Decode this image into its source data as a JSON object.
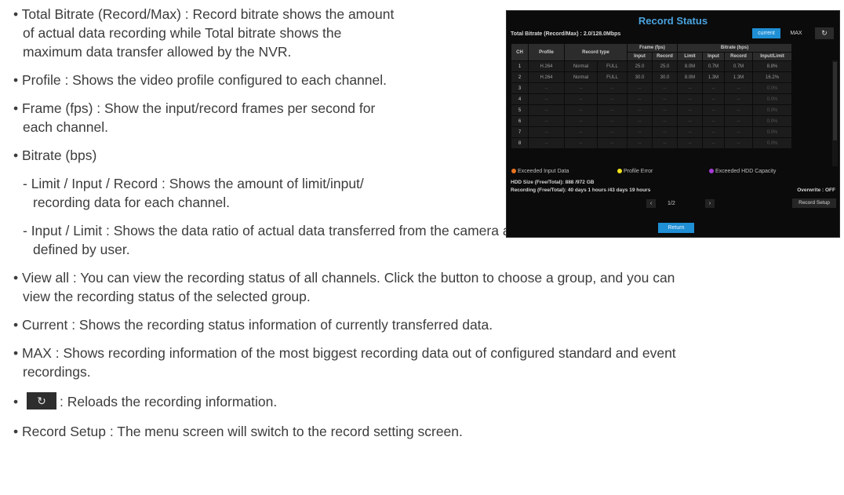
{
  "text": {
    "b1_l1": "• Total Bitrate (Record/Max) : Record bitrate shows the amount",
    "b1_l2": "of actual data recording while Total bitrate shows the",
    "b1_l3": "maximum data transfer allowed by the NVR.",
    "b2": "• Profile : Shows the video profile configured to each channel.",
    "b3_l1": "• Frame (fps) : Show the input/record frames per second for",
    "b3_l2": "each channel.",
    "b4": "• Bitrate (bps)",
    "b5_l1": "- Limit / Input / Record : Shows the amount of limit/input/",
    "b5_l2": "recording data for each channel.",
    "b6_l1": "- Input / Limit : Shows the data ratio of actual data transferred from the camera and allowed maximum",
    "b6_l2": "defined by user.",
    "b7_l1": "• View all : You can view the recording status of all channels. Click the button to choose a group, and you can",
    "b7_l2": "view the recording status of the selected group.",
    "b8": "• Current : Shows the recording status information of currently transferred data.",
    "b9_l1": "• MAX : Shows recording information of the most biggest recording data out of configured standard and event",
    "b9_l2": "recordings.",
    "b10_bullet": "•",
    "b10_text": ": Reloads the recording information.",
    "b11": "• Record Setup : The menu screen will switch to the record setting screen."
  },
  "nvr": {
    "title": "Record Status",
    "total_bitrate": "Total Bitrate (Record/Max) : 2.0/128.0Mbps",
    "btn_current": "current",
    "btn_max": "MAX",
    "headers": {
      "ch": "CH",
      "profile": "Profile",
      "record_type": "Record type",
      "frame": "Frame (fps)",
      "bitrate": "Bitrate (bps)",
      "input": "Input",
      "record": "Record",
      "limit": "Limit",
      "input2": "Input",
      "record2": "Record",
      "input_limit": "Input/Limit"
    },
    "rows": [
      [
        "1",
        "H.264",
        "Normal",
        "FULL",
        "25.0",
        "25.0",
        "8.0M",
        "0.7M",
        "0.7M",
        "8.8%"
      ],
      [
        "2",
        "H.264",
        "Normal",
        "FULL",
        "30.0",
        "30.0",
        "8.0M",
        "1.3M",
        "1.3M",
        "16.2%"
      ],
      [
        "3",
        "--",
        "--",
        "--",
        "--",
        "--",
        "--",
        "--",
        "--",
        "0.0%"
      ],
      [
        "4",
        "--",
        "--",
        "--",
        "--",
        "--",
        "--",
        "--",
        "--",
        "0.0%"
      ],
      [
        "5",
        "--",
        "--",
        "--",
        "--",
        "--",
        "--",
        "--",
        "--",
        "0.0%"
      ],
      [
        "6",
        "--",
        "--",
        "--",
        "--",
        "--",
        "--",
        "--",
        "--",
        "0.0%"
      ],
      [
        "7",
        "--",
        "--",
        "--",
        "--",
        "--",
        "--",
        "--",
        "--",
        "0.0%"
      ],
      [
        "8",
        "--",
        "--",
        "--",
        "--",
        "--",
        "--",
        "--",
        "--",
        "0.0%"
      ]
    ],
    "legend": {
      "exceeded_input": "Exceeded Input Data",
      "profile_error": "Profile Error",
      "exceeded_hdd": "Exceeded HDD Capacity"
    },
    "colors": {
      "accent": "#1f8fd6",
      "exceeded_input": "#e8731e",
      "profile_error": "#f2e21c",
      "exceeded_hdd": "#a63ad6"
    },
    "hdd_size": "HDD Size  (Free/Total):   888 /972 GB",
    "recording": "Recording (Free/Total):   40 days 1 hours  /43 days 19 hours",
    "overwrite": "Overwrite :  OFF",
    "page": "1/2",
    "record_setup": "Record Setup",
    "return": "Return"
  },
  "icons": {
    "refresh": "refresh-icon",
    "prev": "chevron-left-icon",
    "next": "chevron-right-icon"
  }
}
